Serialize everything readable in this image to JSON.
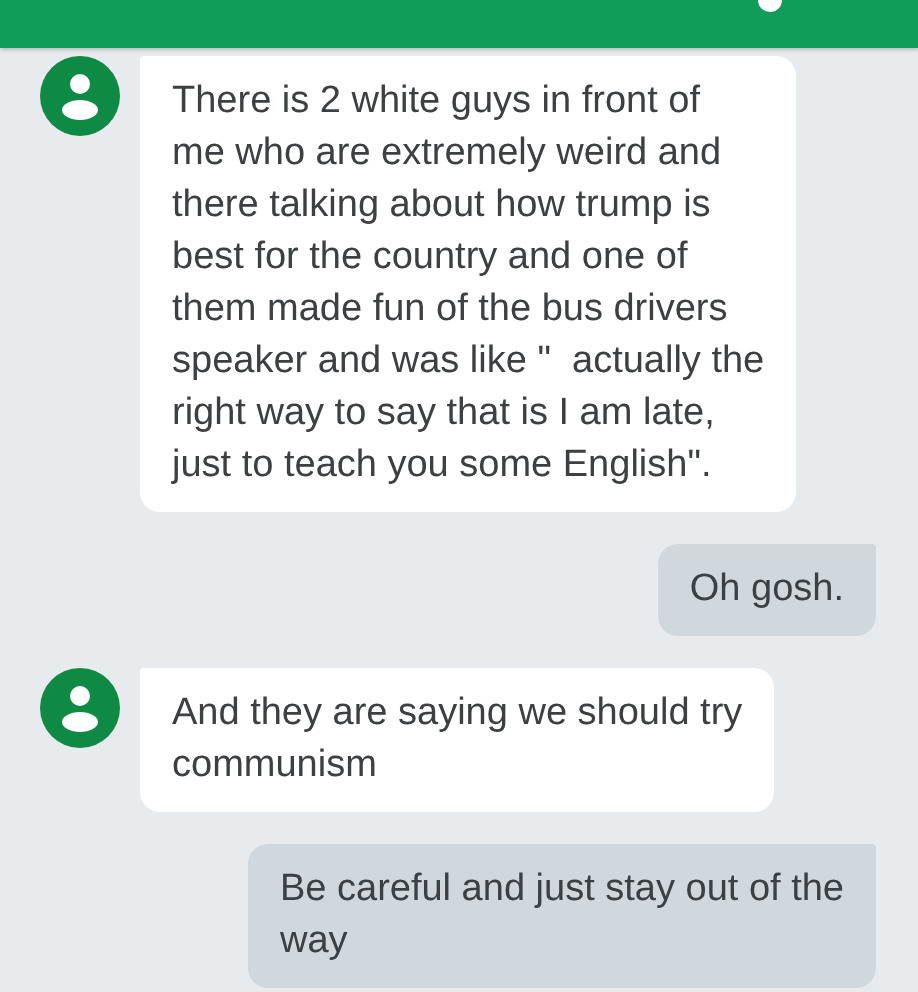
{
  "messages": [
    {
      "kind": "incoming",
      "lines": [
        "There is 2 white guys in front of",
        "me who are extremely weird and",
        "there talking about how trump is",
        "best for the country and one of",
        "them made fun of the bus drivers",
        "speaker and was like \"  actually the",
        "right way to say that is I am late,",
        "just to teach you some English\"."
      ]
    },
    {
      "kind": "outgoing",
      "lines": [
        "Oh gosh."
      ]
    },
    {
      "kind": "incoming",
      "lines": [
        "And they are saying we should try",
        "communism"
      ]
    },
    {
      "kind": "outgoing",
      "lines": [
        "Be careful and just stay out of the",
        "way"
      ]
    }
  ]
}
